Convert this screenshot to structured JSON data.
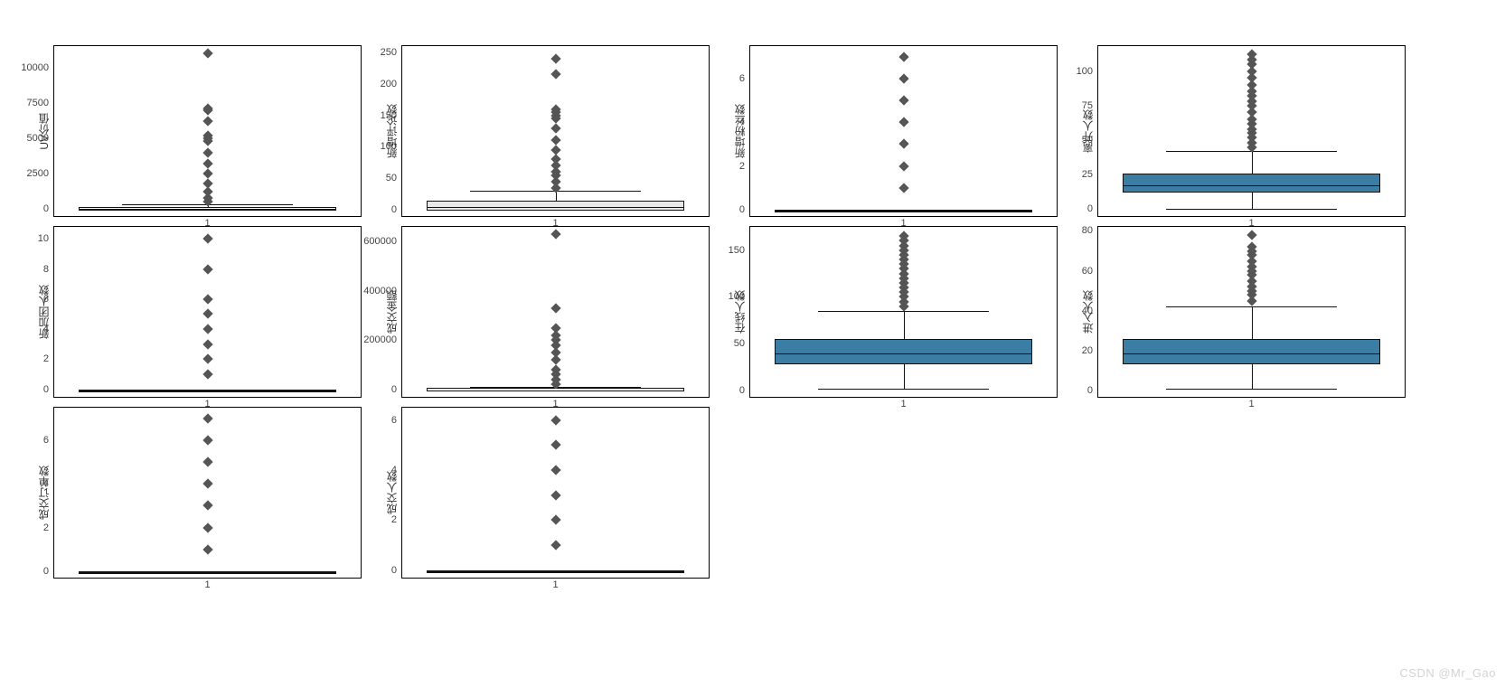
{
  "watermark": "CSDN @Mr_Gao",
  "chart_data": [
    {
      "ylabel": "UV价值",
      "type": "box",
      "box": {
        "q1": 0,
        "median": 50,
        "q3": 120,
        "whisker_low": 0,
        "whisker_high": 300
      },
      "outliers": [
        500,
        800,
        1200,
        1800,
        2500,
        3200,
        4000,
        4800,
        5000,
        5200,
        6200,
        7000,
        7100,
        11000
      ],
      "yticks": [
        0,
        2500,
        5000,
        7500,
        10000
      ],
      "ylim": [
        -500,
        11500
      ],
      "xticks": [
        "1"
      ],
      "box_fill": "#ffffff"
    },
    {
      "ylabel": "新增评论数",
      "type": "box",
      "box": {
        "q1": 2,
        "median": 6,
        "q3": 15,
        "whisker_low": 0,
        "whisker_high": 30
      },
      "outliers": [
        35,
        45,
        55,
        60,
        70,
        80,
        95,
        110,
        130,
        145,
        150,
        155,
        160,
        215,
        240
      ],
      "yticks": [
        0,
        50,
        100,
        150,
        200,
        250
      ],
      "ylim": [
        -10,
        260
      ],
      "xticks": [
        "1"
      ],
      "box_fill": "#e8e8e8"
    },
    {
      "ylabel": "新增粉丝数",
      "type": "box",
      "box": {
        "q1": 0,
        "median": 0,
        "q3": 0,
        "whisker_low": 0,
        "whisker_high": 0
      },
      "outliers": [
        1,
        2,
        3,
        4,
        5,
        6,
        7
      ],
      "yticks": [
        0,
        2,
        4,
        6
      ],
      "ylim": [
        -0.3,
        7.5
      ],
      "xticks": [
        "1"
      ],
      "box_fill": "#ffffff"
    },
    {
      "ylabel": "离开人数",
      "type": "box",
      "box": {
        "q1": 13,
        "median": 18,
        "q3": 26,
        "whisker_low": 0,
        "whisker_high": 42
      },
      "outliers": [
        45,
        48,
        52,
        55,
        58,
        62,
        65,
        70,
        75,
        78,
        82,
        85,
        90,
        95,
        100,
        105,
        108,
        112
      ],
      "yticks": [
        0,
        25,
        50,
        75,
        100
      ],
      "ylim": [
        -5,
        118
      ],
      "xticks": [
        "1"
      ],
      "box_fill": "#3c7ea3"
    },
    {
      "ylabel": "新加团人数",
      "type": "box",
      "box": {
        "q1": 0,
        "median": 0,
        "q3": 0,
        "whisker_low": 0,
        "whisker_high": 0
      },
      "outliers": [
        1,
        2,
        3,
        4,
        5,
        6,
        8,
        10
      ],
      "yticks": [
        0,
        2,
        4,
        6,
        8,
        10
      ],
      "ylim": [
        -0.5,
        10.8
      ],
      "xticks": [
        "1"
      ],
      "box_fill": "#ffffff"
    },
    {
      "ylabel": "成交金额",
      "type": "box",
      "box": {
        "q1": 0,
        "median": 0,
        "q3": 5000,
        "whisker_low": 0,
        "whisker_high": 12000
      },
      "outliers": [
        20000,
        40000,
        60000,
        80000,
        120000,
        150000,
        180000,
        200000,
        220000,
        250000,
        330000,
        630000
      ],
      "yticks": [
        0,
        200000,
        400000,
        600000
      ],
      "ylim": [
        -30000,
        660000
      ],
      "xticks": [
        "1"
      ],
      "box_fill": "#ffffff"
    },
    {
      "ylabel": "在线人数",
      "type": "box",
      "box": {
        "q1": 30,
        "median": 40,
        "q3": 55,
        "whisker_low": 2,
        "whisker_high": 85
      },
      "outliers": [
        90,
        95,
        100,
        105,
        110,
        115,
        120,
        125,
        130,
        135,
        140,
        145,
        150,
        155,
        160,
        165
      ],
      "yticks": [
        0,
        50,
        100,
        150
      ],
      "ylim": [
        -7,
        175
      ],
      "xticks": [
        "1"
      ],
      "box_fill": "#3c7ea3"
    },
    {
      "ylabel": "进入人数",
      "type": "box",
      "box": {
        "q1": 14,
        "median": 19,
        "q3": 26,
        "whisker_low": 1,
        "whisker_high": 42
      },
      "outliers": [
        45,
        48,
        50,
        52,
        55,
        58,
        60,
        62,
        65,
        68,
        70,
        72,
        78
      ],
      "yticks": [
        0,
        20,
        40,
        60,
        80
      ],
      "ylim": [
        -3,
        82
      ],
      "xticks": [
        "1"
      ],
      "box_fill": "#3c7ea3"
    },
    {
      "ylabel": "成交订单数",
      "type": "box",
      "box": {
        "q1": 0,
        "median": 0,
        "q3": 0,
        "whisker_low": 0,
        "whisker_high": 0
      },
      "outliers": [
        1,
        2,
        3,
        4,
        5,
        6,
        7
      ],
      "yticks": [
        0,
        2,
        4,
        6
      ],
      "ylim": [
        -0.3,
        7.5
      ],
      "xticks": [
        "1"
      ],
      "box_fill": "#ffffff"
    },
    {
      "ylabel": "成交人数",
      "type": "box",
      "box": {
        "q1": 0,
        "median": 0,
        "q3": 0,
        "whisker_low": 0,
        "whisker_high": 0
      },
      "outliers": [
        1,
        2,
        3,
        4,
        5,
        6
      ],
      "yticks": [
        0,
        2,
        4,
        6
      ],
      "ylim": [
        -0.3,
        6.5
      ],
      "xticks": [
        "1"
      ],
      "box_fill": "#ffffff"
    }
  ]
}
